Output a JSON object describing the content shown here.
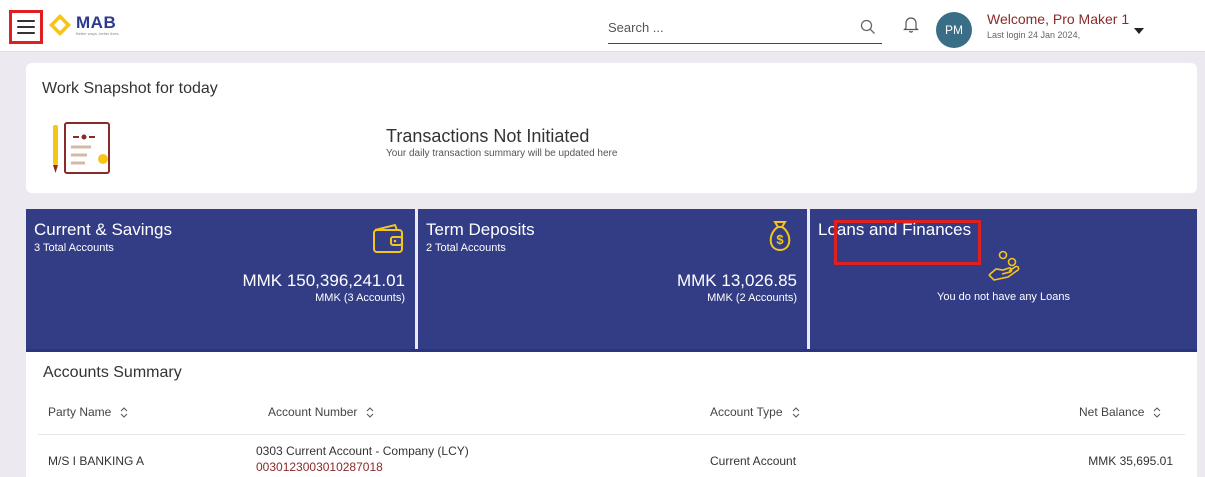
{
  "header": {
    "brand": {
      "name": "MAB",
      "tagline": "Better ways, better lives."
    },
    "search": {
      "placeholder": "Search ..."
    },
    "user": {
      "initials": "PM",
      "welcome": "Welcome, Pro Maker 1",
      "last_login": "Last login 24 Jan 2024,"
    }
  },
  "snapshot": {
    "title": "Work Snapshot for today",
    "status_title": "Transactions Not Initiated",
    "status_sub": "Your daily transaction summary will be updated here"
  },
  "tiles": [
    {
      "title": "Current & Savings",
      "sub": "3 Total Accounts",
      "amount": "MMK 150,396,241.01",
      "amount_sub": "MMK (3 Accounts)",
      "icon": "wallet-icon"
    },
    {
      "title": "Term Deposits",
      "sub": "2 Total Accounts",
      "amount": "MMK 13,026.85",
      "amount_sub": "MMK (2 Accounts)",
      "icon": "money-bag-icon"
    },
    {
      "title": "Loans and Finances",
      "message": "You do not have any Loans",
      "icon": "hand-coins-icon"
    }
  ],
  "summary": {
    "title": "Accounts Summary",
    "columns": [
      "Party Name",
      "Account Number",
      "Account Type",
      "Net Balance"
    ],
    "rows": [
      {
        "party": "M/S I BANKING A",
        "account_desc": "0303 Current Account - Company (LCY)",
        "account_no": "0030123003010287018",
        "type": "Current Account",
        "balance": "MMK 35,695.01"
      }
    ]
  },
  "colors": {
    "brand_blue": "#323d86",
    "accent_maroon": "#8a2a2a",
    "highlight_red": "#e02020",
    "gold": "#f5c518"
  }
}
